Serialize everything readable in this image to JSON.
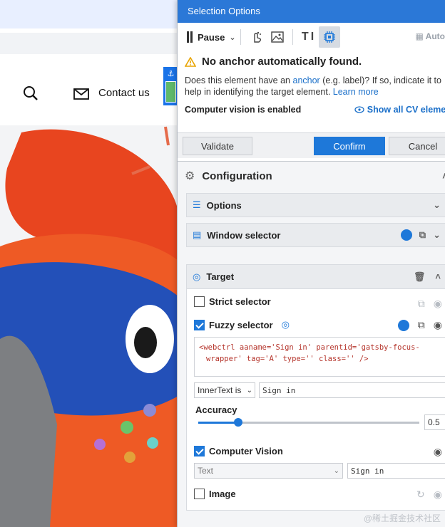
{
  "background_site": {
    "nav_contact_label": "Contact us"
  },
  "panel": {
    "title": "Selection Options",
    "toolbar": {
      "pause_label": "Pause",
      "auto_label": "Auto"
    },
    "warning": {
      "heading": "No anchor automatically found.",
      "desc_part1": "Does this element have an",
      "anchor_link": "anchor",
      "desc_part2": "(e.g. label)? If so, indicate it to",
      "desc_line2": "help in identifying the target element.",
      "learn_more": "Learn more"
    },
    "cv_status": "Computer vision is enabled",
    "show_cv_link": "Show all CV elements",
    "buttons": {
      "validate": "Validate",
      "confirm": "Confirm",
      "cancel": "Cancel"
    },
    "config": {
      "heading": "Configuration",
      "options_label": "Options",
      "window_selector_label": "Window selector",
      "target_label": "Target",
      "strict_selector_label": "Strict selector",
      "fuzzy_selector_label": "Fuzzy selector",
      "selector_text_line1": "<webctrl aaname='Sign in' parentid='gatsby-focus-",
      "selector_text_line2": "wrapper' tag='A' type='' class='' />",
      "match_type": "InnerText is",
      "match_value": "Sign in",
      "accuracy_label": "Accuracy",
      "accuracy_value": "0.5",
      "accuracy_fraction": 0.18,
      "computer_vision_label": "Computer Vision",
      "cv_type": "Text",
      "cv_value": "Sign in",
      "image_label": "Image"
    }
  },
  "watermark": "@稀土掘金技术社区",
  "colors": {
    "accent": "#1e78d9",
    "titlebar": "#2b78d7",
    "warning": "#e8a400"
  }
}
